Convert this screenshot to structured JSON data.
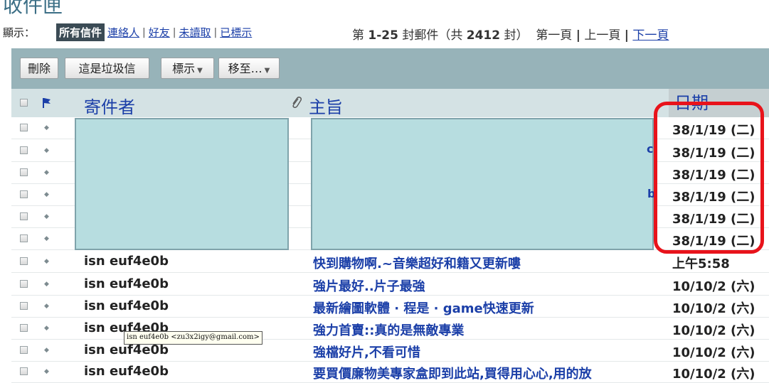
{
  "page": {
    "title": "收件匣"
  },
  "filter_bar": {
    "show_label": "顯示：",
    "active_filter": "所有信件",
    "filters": [
      "連絡人",
      "好友",
      "未讀取",
      "已標示"
    ],
    "separator": "|"
  },
  "pager": {
    "prefix": "第 ",
    "range": "1-25",
    "mid": " 封郵件（共 ",
    "total": "2412",
    "suffix": " 封）",
    "first_page": "第一頁",
    "prev_page": "上一頁",
    "next_page": "下一頁",
    "separator": "|"
  },
  "toolbar": {
    "delete_label": "刪除",
    "spam_label": "這是垃圾信",
    "mark_label": "標示",
    "move_label": "移至…",
    "caret": "▼"
  },
  "columns": {
    "sender": "寄件者",
    "attachment_icon": "paperclip-icon",
    "subject": "主旨",
    "date": "日期"
  },
  "icons": {
    "header_flag": "flag-icon",
    "row_flag": "dot-flag-icon"
  },
  "colors": {
    "toolbar_bg": "#97b3b9",
    "header_bg": "#d4e2e4",
    "subject_link": "#1b3fa8",
    "highlight": "#e8131b",
    "redaction": "#b7dde0"
  },
  "messages": [
    {
      "sender": "",
      "subject": "",
      "date": "38/1/19 (二)"
    },
    {
      "sender": "",
      "subject": "",
      "date": "38/1/19 (二)"
    },
    {
      "sender": "",
      "subject": "",
      "date": "38/1/19 (二)"
    },
    {
      "sender": "",
      "subject": "",
      "date": "38/1/19 (二)"
    },
    {
      "sender": "",
      "subject": "",
      "date": "38/1/19 (二)"
    },
    {
      "sender": "",
      "subject": "",
      "date": "38/1/19 (二)"
    },
    {
      "sender": "isn euf4e0b",
      "subject": "快到購物啊.~音樂超好和籍又更新嘍",
      "date": "上午5:58"
    },
    {
      "sender": "isn euf4e0b",
      "subject": "強片最好..片子最強",
      "date": "10/10/2 (六)"
    },
    {
      "sender": "isn euf4e0b",
      "subject": "最新繪圖軟體 · 程是 · game快速更新",
      "date": "10/10/2 (六)"
    },
    {
      "sender": "isn euf4e0b",
      "subject": "強力首賣::真的是無敵專業",
      "date": "10/10/2 (六)"
    },
    {
      "sender": "isn euf4e0b",
      "subject": "強檔好片,不看可惜",
      "date": "10/10/2 (六)"
    },
    {
      "sender": "isn euf4e0b",
      "subject": "要買價廉物美專家盒即到此站,買得用心心,用的放",
      "date": "10/10/2 (六)"
    }
  ],
  "tooltip": {
    "text": "isn euf4e0b <zu3x2igy@gmail.com>"
  },
  "stray_marks": {
    "row2": "c",
    "row4": "b"
  }
}
